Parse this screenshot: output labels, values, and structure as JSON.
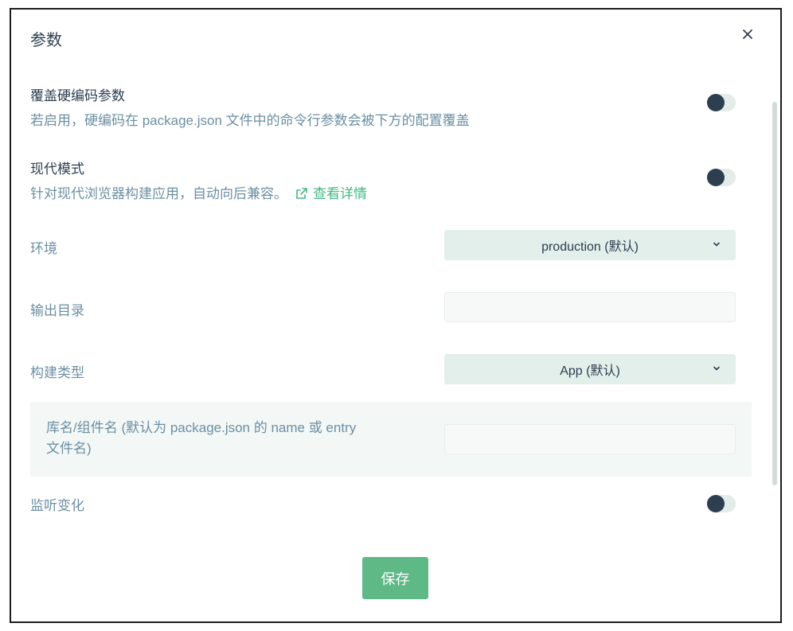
{
  "dialog": {
    "title": "参数",
    "close_icon": "close-icon"
  },
  "params": {
    "override": {
      "title": "覆盖硬编码参数",
      "desc": "若启用，硬编码在 package.json 文件中的命令行参数会被下方的配置覆盖",
      "enabled": false
    },
    "modern": {
      "title": "现代模式",
      "desc": "针对现代浏览器构建应用，自动向后兼容。",
      "link_label": "查看详情",
      "link_icon": "external-link-icon",
      "enabled": false
    },
    "environment": {
      "label": "环境",
      "value": "production (默认)",
      "icon": "chevron-down-icon"
    },
    "output_dir": {
      "label": "输出目录",
      "value": ""
    },
    "build_type": {
      "label": "构建类型",
      "value": "App (默认)",
      "icon": "chevron-down-icon"
    },
    "lib_name": {
      "label_line1": "库名/组件名 (默认为 package.json 的 name 或 entry",
      "label_line2": "文件名)",
      "value": ""
    },
    "watch": {
      "label": "监听变化",
      "enabled": false
    }
  },
  "actions": {
    "save_label": "保存"
  },
  "colors": {
    "accent": "#42b983",
    "save_button": "#5fb987",
    "toggle_knob": "#2c3e50",
    "toggle_track": "#e4ece9",
    "select_bg": "#e3efea"
  }
}
